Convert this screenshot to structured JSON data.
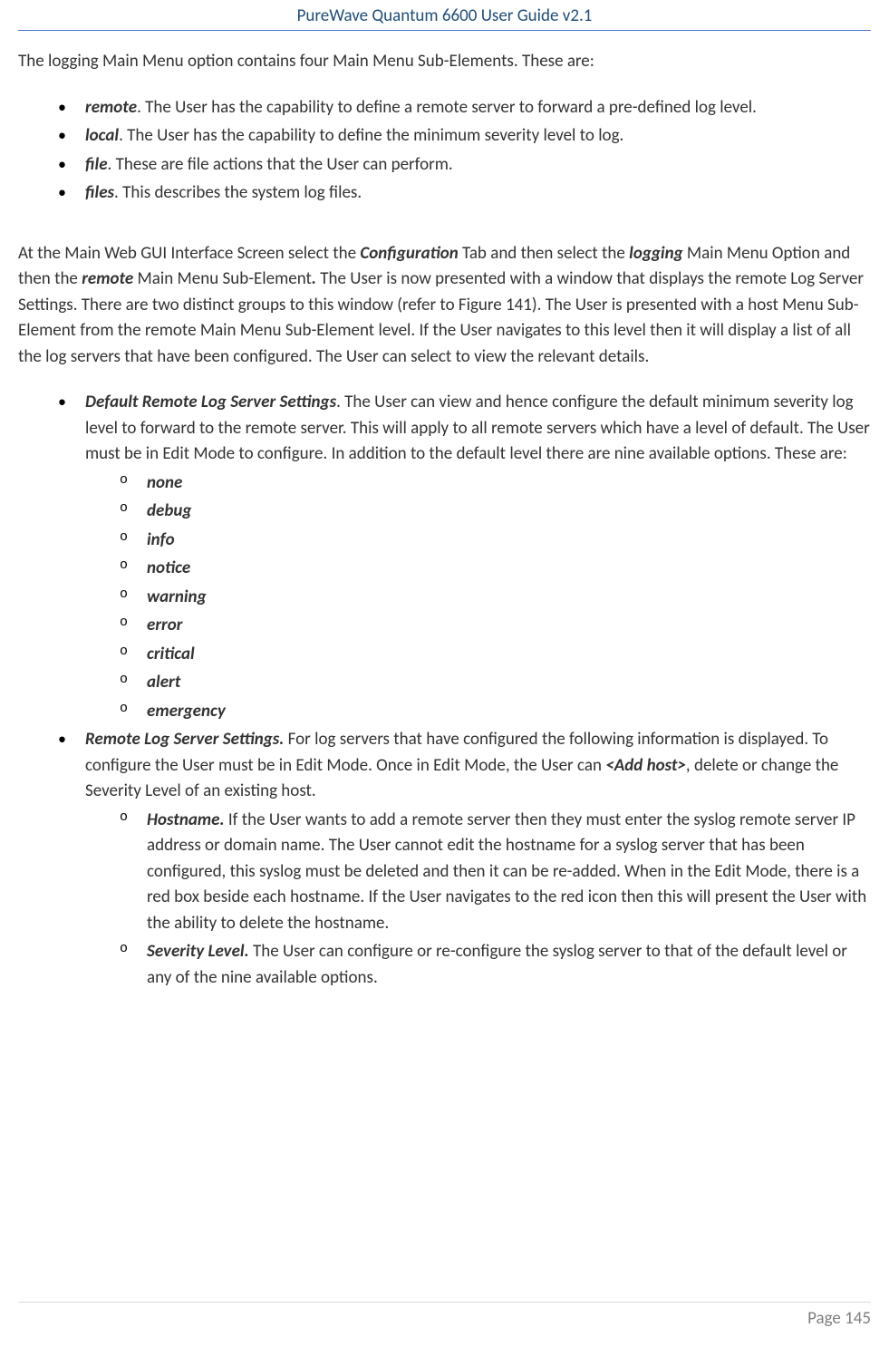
{
  "header": {
    "title": "PureWave Quantum 6600 User Guide v2.1"
  },
  "intro": "The logging Main Menu option contains four Main Menu Sub-Elements. These are:",
  "mainItems": [
    {
      "term": "remote",
      "desc": ". The User has the capability to define a remote server to forward a pre-defined log level."
    },
    {
      "term": "local",
      "desc": ". The User has the capability to define the minimum severity level to log."
    },
    {
      "term": "file",
      "desc": ". These are file actions that the User can perform."
    },
    {
      "term": "files",
      "desc": ". This describes the system log files."
    }
  ],
  "sectionPara": {
    "t1": "At the Main Web GUI Interface Screen select the ",
    "b1": "Configuration",
    "t2": " Tab and then select the ",
    "b2": "logging",
    "t3": " Main Menu Option and then the ",
    "b3": "remote",
    "t4": " Main Menu Sub-Element",
    "b4": ".",
    "t5": " The User is now presented with a window that displays the remote Log Server Settings. There are two distinct groups to this window (refer to Figure 141). The User is presented with a host Menu Sub-Element from the remote Main Menu Sub-Element level. If the User navigates to this level then it will display a list of all the log servers that have been configured. The User can select to view the relevant details."
  },
  "nested": {
    "item1": {
      "term": "Default Remote Log Server Settings",
      "desc": ". The User can view and hence configure the default minimum severity log level to forward to the remote server. This will apply to all remote servers which have a level of default. The User must be in Edit Mode to configure. In addition to the default level there are nine available options. These are:",
      "options": [
        "none",
        "debug",
        "info",
        "notice",
        "warning",
        "error",
        "critical",
        "alert",
        "emergency"
      ]
    },
    "item2": {
      "term": "Remote Log Server Settings.",
      "t1": " For log servers that have configured the following information is displayed. To configure the User must be in Edit Mode. Once in Edit Mode, the User can ",
      "b1": "<Add host>",
      "t2": ", delete or change the Severity Level of an existing host.",
      "sub1": {
        "term": "Hostname.",
        "desc": " If the User wants to add a remote server then they must enter the syslog remote server IP address or domain name. The User cannot edit the hostname for a syslog server that has been configured, this syslog must be deleted and then it can be re-added. When in the Edit Mode, there is a red box beside each hostname. If the User navigates to the red icon then this will present the User with the ability to delete the hostname."
      },
      "sub2": {
        "term": "Severity Level.",
        "desc": " The User can configure or re-configure the syslog server to that of the default level or any of the nine available options."
      }
    }
  },
  "footer": {
    "pageLabel": "Page 145"
  }
}
